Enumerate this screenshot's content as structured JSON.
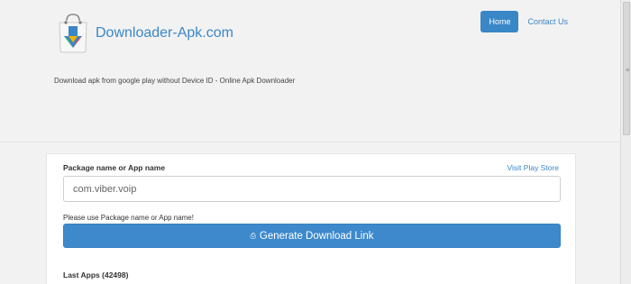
{
  "brand": {
    "name": "Downloader-Apk.com"
  },
  "nav": {
    "home": "Home",
    "contact": "Contact Us"
  },
  "tagline": "Download apk from google play without Device ID - Online Apk Downloader",
  "form": {
    "package_label": "Package name or App name",
    "visit_link": "Visit Play Store",
    "input_value": "com.viber.voip",
    "hint": "Please use Package name or App name!",
    "generate_label": "Generate Download Link"
  },
  "last_apps": "Last Apps (42498)",
  "colors": {
    "accent": "#3a87c8",
    "page_bg": "#f2f2f2"
  }
}
